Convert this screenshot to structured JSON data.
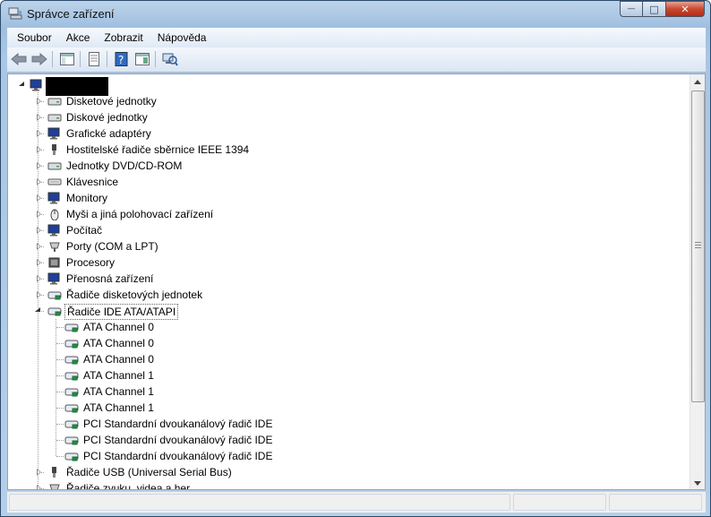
{
  "window": {
    "title": "Správce zařízení"
  },
  "caption": {
    "minimize": "—",
    "maximize": "□",
    "close": "✕"
  },
  "menu": [
    "Soubor",
    "Akce",
    "Zobrazit",
    "Nápověda"
  ],
  "toolbar": [
    {
      "name": "back-icon"
    },
    {
      "name": "forward-icon"
    },
    {
      "name": "show-hide-tree-icon"
    },
    {
      "name": "properties-icon"
    },
    {
      "name": "help-icon"
    },
    {
      "name": "show-console-icon"
    },
    {
      "name": "scan-hardware-icon"
    }
  ],
  "tree": {
    "root_label": "",
    "categories": [
      {
        "label": "Disketové jednotky",
        "icon": "floppy-drive-icon"
      },
      {
        "label": "Diskové jednotky",
        "icon": "disk-drive-icon"
      },
      {
        "label": "Grafické adaptéry",
        "icon": "display-adapter-icon"
      },
      {
        "label": "Hostitelské řadiče sběrnice IEEE 1394",
        "icon": "ieee1394-icon"
      },
      {
        "label": "Jednotky DVD/CD-ROM",
        "icon": "dvd-drive-icon"
      },
      {
        "label": "Klávesnice",
        "icon": "keyboard-icon"
      },
      {
        "label": "Monitory",
        "icon": "monitor-icon"
      },
      {
        "label": "Myši a jiná polohovací zařízení",
        "icon": "mouse-icon"
      },
      {
        "label": "Počítač",
        "icon": "computer-icon"
      },
      {
        "label": "Porty (COM a LPT)",
        "icon": "port-icon"
      },
      {
        "label": "Procesory",
        "icon": "processor-icon"
      },
      {
        "label": "Přenosná zařízení",
        "icon": "portable-device-icon"
      },
      {
        "label": "Řadiče disketových jednotek",
        "icon": "floppy-controller-icon"
      },
      {
        "label": "Řadiče IDE ATA/ATAPI",
        "icon": "ide-controller-icon",
        "expanded": true,
        "selected": true
      },
      {
        "label": "Řadiče USB (Universal Serial Bus)",
        "icon": "usb-icon"
      },
      {
        "label": "Řadiče zvuku, videa a her",
        "icon": "sound-icon"
      }
    ],
    "ide_children": [
      "ATA Channel 0",
      "ATA Channel 0",
      "ATA Channel 0",
      "ATA Channel 1",
      "ATA Channel 1",
      "ATA Channel 1",
      "PCI Standardní dvoukanálový řadič IDE",
      "PCI Standardní dvoukanálový řadič IDE",
      "PCI Standardní dvoukanálový řadič IDE"
    ]
  },
  "colors": {
    "selection_border": "#666666",
    "title_bar": "#a9c6e4",
    "close_button": "#c74a32"
  }
}
